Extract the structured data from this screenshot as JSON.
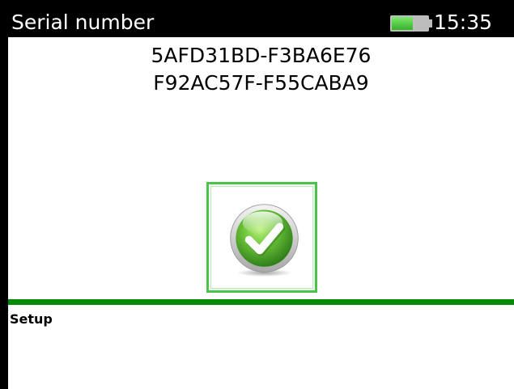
{
  "header": {
    "title": "Serial number",
    "time": "15:35",
    "battery_icon": "battery-icon",
    "battery_level": 0.6
  },
  "serial": {
    "line1": "5AFD31BD-F3BA6E76",
    "line2": "F92AC57F-F55CABA9"
  },
  "status": {
    "icon": "check-icon",
    "color": "#4cc24a"
  },
  "footer": {
    "label": "Setup",
    "divider_color": "#008a00"
  }
}
